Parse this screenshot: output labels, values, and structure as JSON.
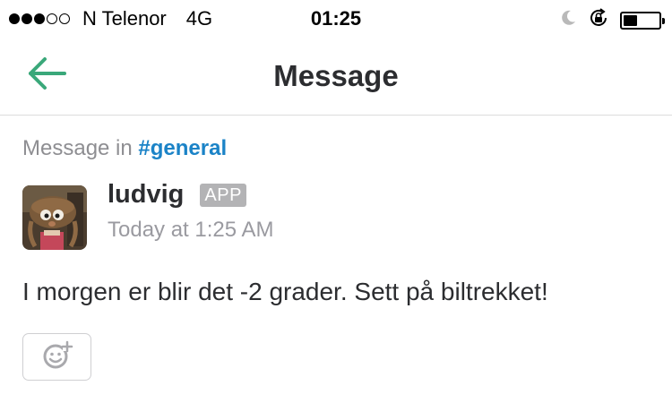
{
  "status_bar": {
    "carrier": "N Telenor",
    "network": "4G",
    "time": "01:25",
    "signal_bars_filled": 3,
    "signal_bars_total": 5,
    "battery_level": 0.4,
    "icons": [
      "moon-icon",
      "orientation-lock-icon",
      "battery-icon"
    ]
  },
  "nav": {
    "title": "Message",
    "back_icon": "back-arrow-icon",
    "accent_color": "#3aa87a"
  },
  "message": {
    "context_prefix": "Message in",
    "channel": "#general",
    "channel_color": "#1b83c7",
    "author": "ludvig",
    "badge": "APP",
    "timestamp": "Today at 1:25 AM",
    "text": "I morgen er blir det -2 grader. Sett på biltrekket!",
    "avatar_icon": "puppet-avatar",
    "reaction_icon": "add-reaction-icon"
  }
}
